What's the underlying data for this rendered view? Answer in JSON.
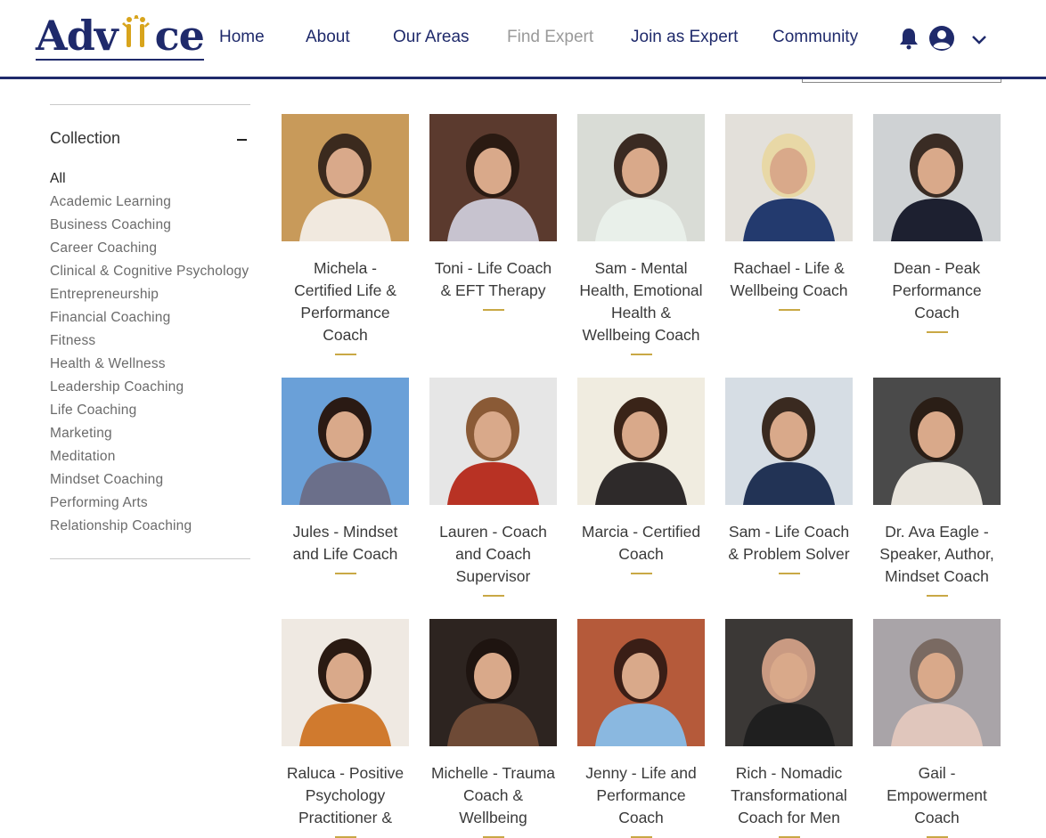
{
  "brand": {
    "logo_left": "Adv",
    "logo_right": "ce",
    "logo_color": "#1f2a6b",
    "figure_color": "#d8a41c"
  },
  "nav": {
    "items": [
      {
        "label": "Home"
      },
      {
        "label": "About"
      },
      {
        "label": "Our Areas"
      },
      {
        "label": "Find Expert",
        "active": true
      },
      {
        "label": "Join as Expert"
      },
      {
        "label": "Community"
      }
    ],
    "icons": [
      "bell-icon",
      "user-avatar-icon",
      "chevron-down-icon"
    ]
  },
  "sidebar": {
    "heading": "Collection",
    "collapse_icon": "minus-icon",
    "categories": [
      "All",
      "Academic Learning",
      "Business Coaching",
      "Career Coaching",
      "Clinical & Cognitive Psychology",
      "Entrepreneurship",
      "Financial Coaching",
      "Fitness",
      "Health & Wellness",
      "Leadership Coaching",
      "Life Coaching",
      "Marketing",
      "Meditation",
      "Mindset Coaching",
      "Performing Arts",
      "Relationship Coaching"
    ],
    "selected": "All"
  },
  "experts": [
    {
      "lines": [
        "Michela -",
        "Certified Life &",
        "Performance",
        "Coach"
      ]
    },
    {
      "lines": [
        "Toni - Life Coach",
        "& EFT Therapy"
      ]
    },
    {
      "lines": [
        "Sam - Mental",
        "Health, Emotional",
        "Health &",
        "Wellbeing Coach"
      ]
    },
    {
      "lines": [
        "Rachael - Life &",
        "Wellbeing Coach"
      ]
    },
    {
      "lines": [
        "Dean - Peak",
        "Performance",
        "Coach"
      ]
    },
    {
      "lines": [
        "Jules - Mindset",
        "and Life Coach"
      ]
    },
    {
      "lines": [
        "Lauren - Coach",
        "and Coach",
        "Supervisor"
      ]
    },
    {
      "lines": [
        "Marcia - Certified",
        "Coach"
      ]
    },
    {
      "lines": [
        "Sam - Life Coach",
        "& Problem Solver"
      ]
    },
    {
      "lines": [
        "Dr. Ava Eagle -",
        "Speaker, Author,",
        "Mindset Coach"
      ]
    },
    {
      "lines": [
        "Raluca - Positive",
        "Psychology",
        "Practitioner &"
      ]
    },
    {
      "lines": [
        "Michelle - Trauma",
        "Coach &",
        "Wellbeing"
      ]
    },
    {
      "lines": [
        "Jenny - Life and",
        "Performance",
        "Coach"
      ]
    },
    {
      "lines": [
        "Rich - Nomadic",
        "Transformational",
        "Coach for Men"
      ]
    },
    {
      "lines": [
        "Gail -",
        "Empowerment",
        "Coach"
      ]
    }
  ],
  "accent_color": "#c9a845"
}
